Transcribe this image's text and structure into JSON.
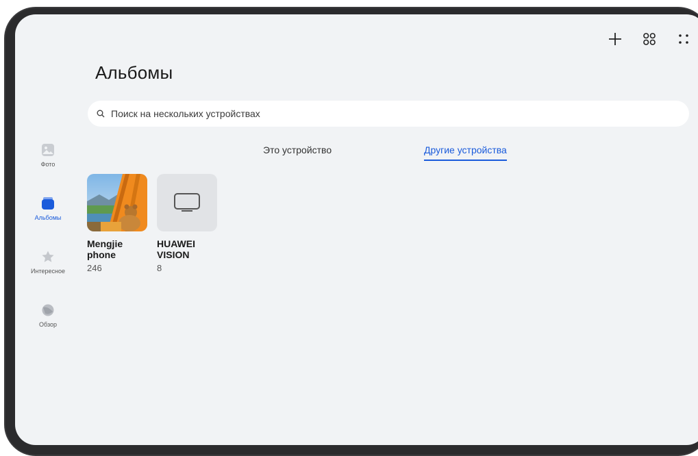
{
  "header": {
    "title": "Альбомы"
  },
  "toolbar": {
    "add_icon": "plus-icon",
    "view_icon": "grid-icon",
    "more_icon": "more-dots-icon"
  },
  "search": {
    "placeholder": "Поиск на нескольких устройствах",
    "value": ""
  },
  "tabs": [
    {
      "label": "Это устройство",
      "active": false
    },
    {
      "label": "Другие устройства",
      "active": true
    }
  ],
  "sidebar": {
    "items": [
      {
        "label": "Фото",
        "icon": "photo-icon",
        "active": false
      },
      {
        "label": "Альбомы",
        "icon": "albums-icon",
        "active": true
      },
      {
        "label": "Интересное",
        "icon": "star-icon",
        "active": false
      },
      {
        "label": "Обзор",
        "icon": "discover-icon",
        "active": false
      }
    ]
  },
  "albums": [
    {
      "name": "Mengjie phone",
      "count": "246",
      "thumb": "tent-photo"
    },
    {
      "name": "HUAWEI VISION",
      "count": "8",
      "thumb": "tv-icon"
    }
  ],
  "colors": {
    "accent": "#1a5bdb",
    "background": "#f1f3f5",
    "bezel": "#3a3a3c"
  }
}
